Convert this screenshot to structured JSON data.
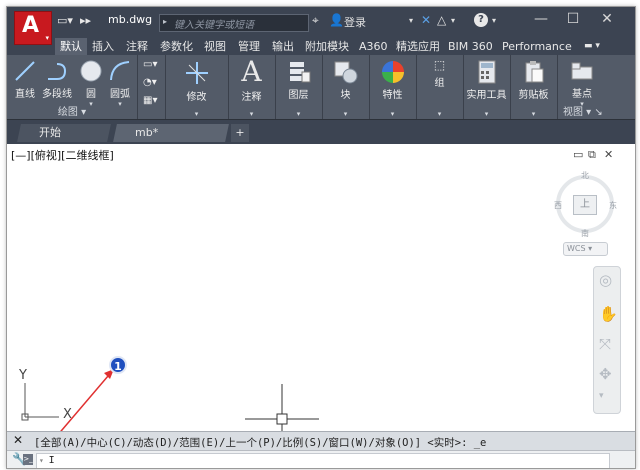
{
  "window": {
    "title": "mb.dwg",
    "search_placeholder": "键入关键字或短语",
    "login_label": "登录"
  },
  "ribbon_tabs": [
    {
      "label": "默认",
      "active": true
    },
    {
      "label": "插入"
    },
    {
      "label": "注释"
    },
    {
      "label": "参数化"
    },
    {
      "label": "视图"
    },
    {
      "label": "管理"
    },
    {
      "label": "输出"
    },
    {
      "label": "附加模块"
    },
    {
      "label": "A360"
    },
    {
      "label": "精选应用"
    },
    {
      "label": "BIM 360"
    },
    {
      "label": "Performance"
    }
  ],
  "ribbon": {
    "draw": {
      "panel_label": "绘图",
      "line": "直线",
      "polyline": "多段线",
      "circle": "圆",
      "arc": "圆弧"
    },
    "modify": "修改",
    "annotation": "注释",
    "layers": "图层",
    "block": "块",
    "properties": "特性",
    "groups": "组",
    "utilities": "实用工具",
    "clipboard": "剪贴板",
    "base": "基点",
    "view_panel": "视图"
  },
  "doc_tabs": {
    "start": "开始",
    "drawing": "mb*",
    "new": "+"
  },
  "viewport": {
    "label": "[—][俯视][二维线框]",
    "viewcube_face": "上",
    "north": "北",
    "south": "南",
    "west": "西",
    "east": "东",
    "wcs": "WCS"
  },
  "ucs": {
    "x": "X",
    "y": "Y"
  },
  "annotation_marker": "1",
  "command": {
    "history": "[全部(A)/中心(C)/动态(D)/范围(E)/上一个(P)/比例(S)/窗口(W)/对象(O)] <实时>: _e",
    "input_value": "I"
  },
  "colors": {
    "accent": "#c8191f",
    "marker": "#1f4fbf",
    "arrow": "#e03030",
    "ribbon_bg": "#535b68"
  }
}
